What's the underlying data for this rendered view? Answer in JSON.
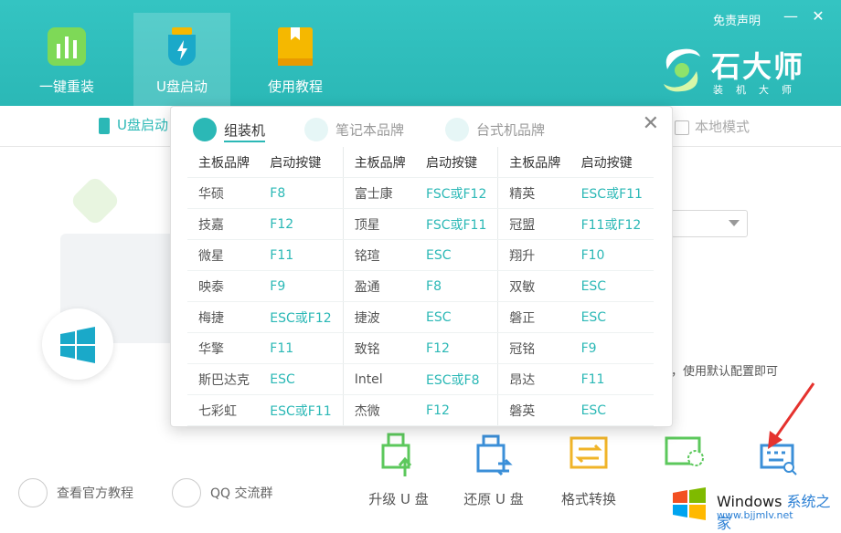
{
  "header": {
    "disclaimer": "免责声明",
    "nav": [
      {
        "label": "一键重装",
        "icon": "bar-chart-icon"
      },
      {
        "label": "U盘启动",
        "icon": "usb-bolt-icon"
      },
      {
        "label": "使用教程",
        "icon": "book-icon"
      }
    ],
    "brand_title": "石大师",
    "brand_sub": "装机大师"
  },
  "tabs": {
    "u_boot": "U盘启动",
    "local_mode": "本地模式"
  },
  "popup": {
    "tabs": [
      "组装机",
      "笔记本品牌",
      "台式机品牌"
    ],
    "headers": [
      "主板品牌",
      "启动按键",
      "主板品牌",
      "启动按键",
      "主板品牌",
      "启动按键"
    ],
    "rows": [
      [
        "华硕",
        "F8",
        "富士康",
        "FSC或F12",
        "精英",
        "ESC或F11"
      ],
      [
        "技嘉",
        "F12",
        "顶星",
        "FSC或F11",
        "冠盟",
        "F11或F12"
      ],
      [
        "微星",
        "F11",
        "铭瑄",
        "ESC",
        "翔升",
        "F10"
      ],
      [
        "映泰",
        "F9",
        "盈通",
        "F8",
        "双敏",
        "ESC"
      ],
      [
        "梅捷",
        "ESC或F12",
        "捷波",
        "ESC",
        "磐正",
        "ESC"
      ],
      [
        "华擎",
        "F11",
        "致铭",
        "F12",
        "冠铭",
        "F9"
      ],
      [
        "斯巴达克",
        "ESC",
        "Intel",
        "ESC或F8",
        "昂达",
        "F11"
      ],
      [
        "七彩虹",
        "ESC或F11",
        "杰微",
        "F12",
        "磐英",
        "ESC"
      ]
    ]
  },
  "background": {
    "hint_text": "，使用默认配置即可"
  },
  "bottom": {
    "tutorial": "查看官方教程",
    "qq": "QQ 交流群",
    "tools": [
      "升级 U 盘",
      "还原 U 盘",
      "格式转换"
    ]
  },
  "watermark": {
    "title": "Windows",
    "title_cn": "系统之家",
    "url": "www.bjjmlv.net"
  },
  "colors": {
    "accent": "#2bb8b6",
    "header_bg": "#34c4c2"
  }
}
